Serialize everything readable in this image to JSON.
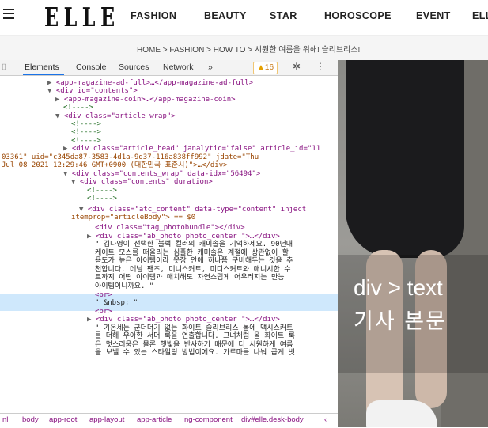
{
  "site": {
    "logo": "ELLE",
    "nav": [
      "FASHION",
      "BEAUTY",
      "STAR",
      "HOROSCOPE",
      "EVENT",
      "ELL"
    ],
    "breadcrumb": "HOME  >  FASHION  >  HOW TO  >  시원한 여름을 위해! 슬리브리스!"
  },
  "devtools": {
    "tabs": [
      "Elements",
      "Console",
      "Sources",
      "Network",
      "»"
    ],
    "active_tab": "Elements",
    "warning_count": "16",
    "lines": [
      "<app-magazine-ad-full>…</app-magazine-ad-full>",
      "<div id=\"contents\">",
      "<app-magazine-coin>…</app-magazine-coin>",
      "<!---->",
      "<div class=\"article_wrap\">",
      "<!---->",
      "<!---->",
      "<!---->",
      "<div class=\"article_head\" janalytic=\"false\" article_id=\"11",
      "03361\" uid=\"c345da87-3583-4d1a-9d37-116a838ff992\" jdate=\"Thu",
      "Jul 08 2021 12:29:46 GMT+0900 (대한민국 표준시)\">…</div>",
      "<div class=\"contents_wrap\" data-idx=\"56494\">",
      "<div class=\"contents\" duration>",
      "<!---->",
      "<!---->",
      "<div class=\"atc_content\" data-type=\"content\" inject",
      "itemprop=\"articleBody\"> == $0",
      "<div class=\"tag_photobundle\"></div>",
      "<div class=\"ab_photo photo_center \">…</div>",
      "\" 김나영이 선택한 블랙 컬러의 캐미솔을 기억하세요. 90년대",
      "케이트 모스를 떠올리는 심플한 캐미솔은 계절에 상관없이 활",
      "용도가 높은 아이템이라 옷장 안에 하나쯤 구비해두는 것을 추",
      "천합니다. 데님 팬츠, 미니스커트, 미디스커트와 매니시한 수",
      "트까지 어떤 아이템과 매치해도 자연스럽게 어우러지는 만능",
      "아이템이니까요. \"",
      "<br>",
      "\" &nbsp; \"",
      "<br>",
      "<div class=\"ab_photo photo_center \">…</div>",
      "\" 기온세는 군더더기 없는 화이트 슬리브리스 톱에 맥시스커트",
      "를 더해 우아한 서머 룩을 연출합니다. 그녀처럼 올 화이트 룩",
      "은 멋스러움은 물론 햇빛을 반사하기 때문에 더 시원하게 여름",
      "을 보낼 수 있는 스타일링 방법이에요. 가르마를 나눠 곱게 빗"
    ],
    "status": [
      "nl",
      "body",
      "app-root",
      "app-layout",
      "app-article",
      "ng-component",
      "div#elle.desk-body",
      "‹"
    ]
  },
  "photo": {
    "overlay_line1": "div > text",
    "overlay_line2": "기사 본문"
  }
}
